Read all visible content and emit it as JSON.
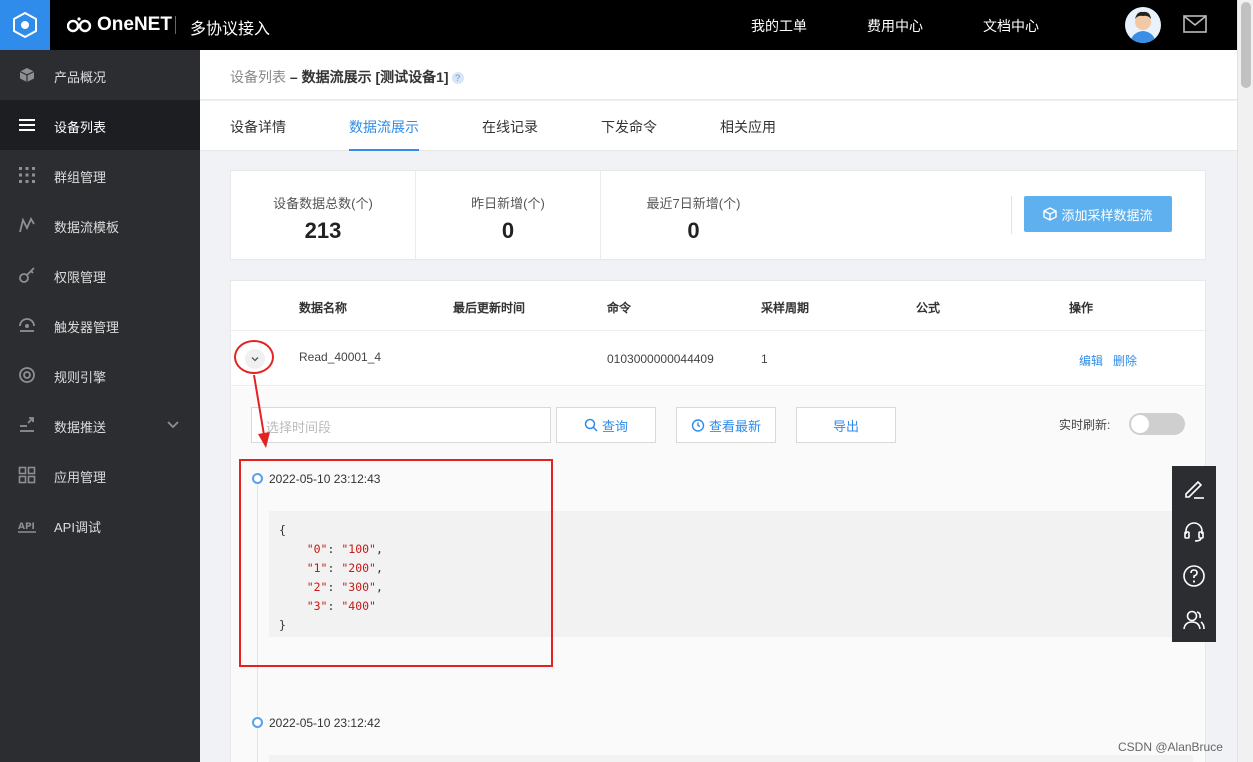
{
  "topbar": {
    "brand": "OneNET",
    "product": "多协议接入",
    "nav": [
      "我的工单",
      "费用中心",
      "文档中心"
    ]
  },
  "sidebar": {
    "items": [
      {
        "label": "产品概况",
        "icon": "cube-icon"
      },
      {
        "label": "设备列表",
        "icon": "list-icon",
        "active": true
      },
      {
        "label": "群组管理",
        "icon": "grid-dots-icon"
      },
      {
        "label": "数据流模板",
        "icon": "stream-icon"
      },
      {
        "label": "权限管理",
        "icon": "key-icon"
      },
      {
        "label": "触发器管理",
        "icon": "trigger-icon"
      },
      {
        "label": "规则引擎",
        "icon": "rule-icon"
      },
      {
        "label": "数据推送",
        "icon": "push-icon",
        "expandable": true
      },
      {
        "label": "应用管理",
        "icon": "apps-icon"
      },
      {
        "label": "API调试",
        "icon": "api-icon"
      }
    ]
  },
  "breadcrumb": {
    "link": "设备列表",
    "separator": "–",
    "current": "数据流展示 [测试设备1]",
    "help": "?"
  },
  "tabs": [
    {
      "label": "设备详情"
    },
    {
      "label": "数据流展示",
      "active": true
    },
    {
      "label": "在线记录"
    },
    {
      "label": "下发命令"
    },
    {
      "label": "相关应用"
    }
  ],
  "stats": [
    {
      "label": "设备数据总数(个)",
      "value": "213"
    },
    {
      "label": "昨日新增(个)",
      "value": "0"
    },
    {
      "label": "最近7日新增(个)",
      "value": "0"
    }
  ],
  "add_button": "添加采样数据流",
  "table": {
    "headers": [
      "数据名称",
      "最后更新时间",
      "命令",
      "采样周期",
      "公式",
      "操作"
    ],
    "row": {
      "name": "Read_40001_4",
      "updated": "",
      "command": "0103000000044409",
      "period": "1",
      "formula": "",
      "edit": "编辑",
      "delete": "删除"
    }
  },
  "detail": {
    "time_placeholder": "选择时间段",
    "query": "查询",
    "latest": "查看最新",
    "export": "导出",
    "realtime_label": "实时刷新:",
    "realtime_on": false,
    "entries": [
      {
        "time": "2022-05-10 23:12:43",
        "json": [
          {
            "key": "\"0\"",
            "value": "\"100\""
          },
          {
            "key": "\"1\"",
            "value": "\"200\""
          },
          {
            "key": "\"2\"",
            "value": "\"300\""
          },
          {
            "key": "\"3\"",
            "value": "\"400\""
          }
        ]
      },
      {
        "time": "2022-05-10 23:12:42"
      }
    ]
  },
  "watermark": "CSDN @AlanBruce",
  "colors": {
    "accent": "#2f8ceb",
    "annotation": "#e52222",
    "sidebar": "#2b2d31"
  }
}
